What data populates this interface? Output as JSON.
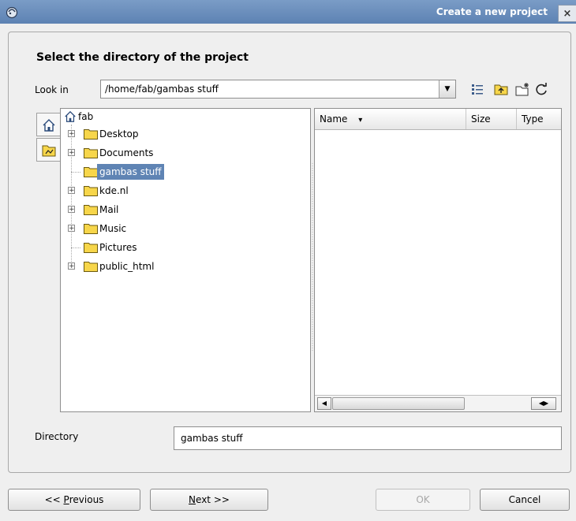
{
  "window": {
    "title": "Create a new project",
    "close_glyph": "×",
    "app_icon": "gambas-shrimp-icon"
  },
  "heading": "Select the directory of the project",
  "lookin": {
    "label": "Look in",
    "path": "/home/fab/gambas stuff",
    "arrow": "▼",
    "tools": [
      "detailed-view-icon",
      "parent-folder-icon",
      "new-folder-icon",
      "reload-icon"
    ]
  },
  "places": [
    "home-icon",
    "recent-folder-icon"
  ],
  "tree": {
    "root": "fab",
    "items": [
      {
        "label": "Desktop",
        "expandable": true,
        "selected": false
      },
      {
        "label": "Documents",
        "expandable": true,
        "selected": false
      },
      {
        "label": "gambas stuff",
        "expandable": false,
        "selected": true
      },
      {
        "label": "kde.nl",
        "expandable": true,
        "selected": false
      },
      {
        "label": "Mail",
        "expandable": true,
        "selected": false
      },
      {
        "label": "Music",
        "expandable": true,
        "selected": false
      },
      {
        "label": "Pictures",
        "expandable": false,
        "selected": false
      },
      {
        "label": "public_html",
        "expandable": true,
        "selected": false
      }
    ],
    "expander_glyph": "+"
  },
  "list": {
    "columns": [
      {
        "label": "Name",
        "sort": "▾"
      },
      {
        "label": "Size"
      },
      {
        "label": "Type"
      }
    ],
    "scroll_left": "◀",
    "scroll_right": "◀▶"
  },
  "directory": {
    "label": "Directory",
    "value": "gambas stuff"
  },
  "buttons": {
    "previous": {
      "pre": "<< ",
      "mnemonic": "P",
      "post": "revious"
    },
    "next": {
      "mnemonic": "N",
      "post": "ext >>"
    },
    "ok": "OK",
    "cancel": "Cancel"
  },
  "colors": {
    "selection": "#5f84b4",
    "titlebar": "#6a8ebd",
    "folder": "#f7d64a"
  }
}
